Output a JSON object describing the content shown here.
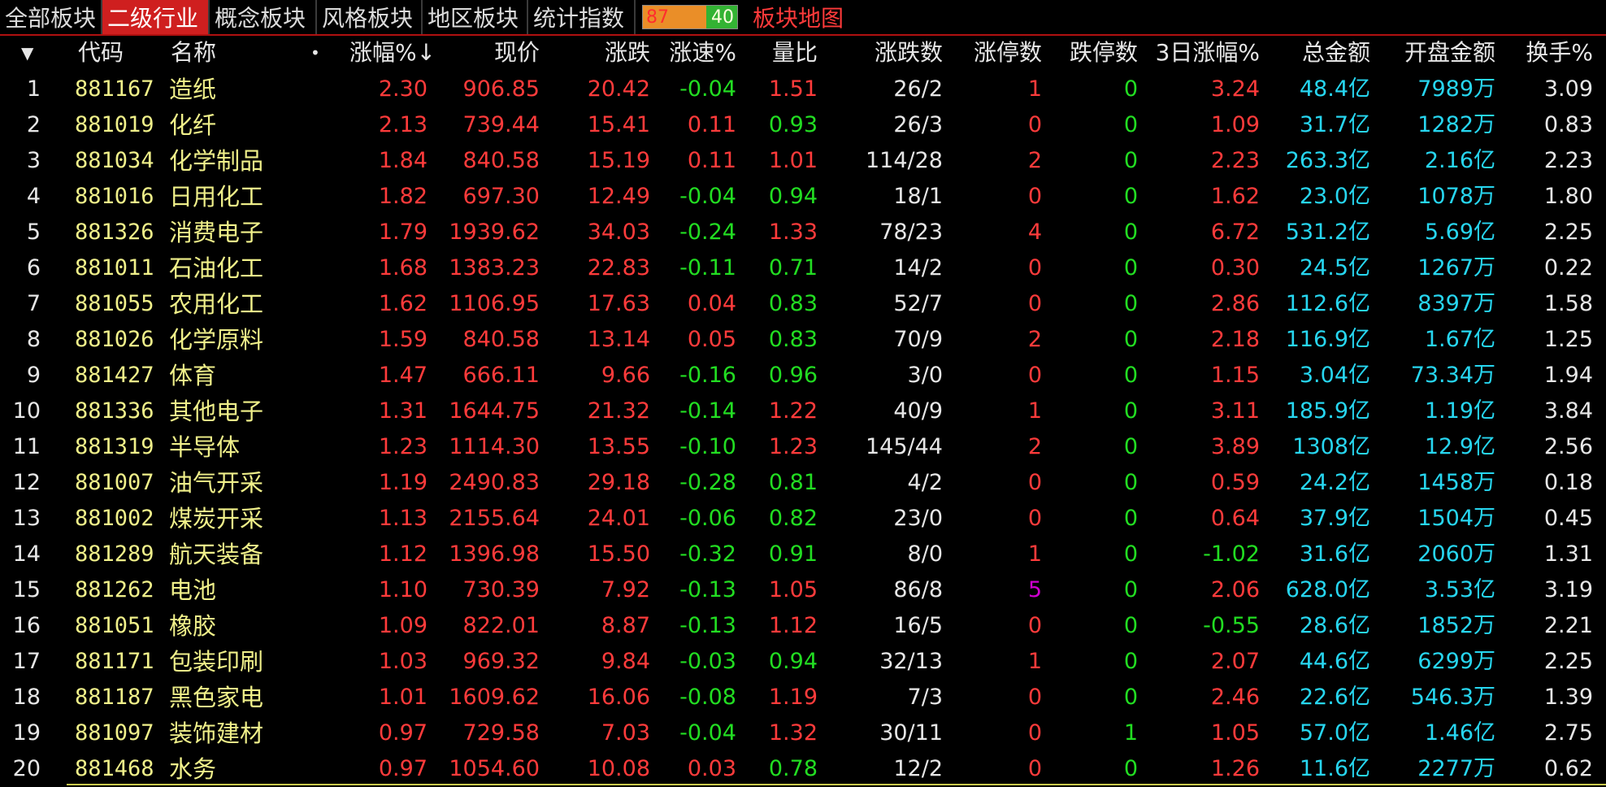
{
  "tabs": [
    {
      "label": "全部板块",
      "active": false
    },
    {
      "label": "二级行业",
      "active": true
    },
    {
      "label": "概念板块",
      "active": false
    },
    {
      "label": "风格板块",
      "active": false
    },
    {
      "label": "地区板块",
      "active": false
    },
    {
      "label": "统计指数",
      "active": false
    }
  ],
  "ratio": {
    "up": "87",
    "down": "40"
  },
  "map_link": "板块地图",
  "header": {
    "dropdown": "▼",
    "code": "代码",
    "name": "名称",
    "dot": "•",
    "change_pct": "涨幅%",
    "sort_arrow": "↓",
    "price": "现价",
    "change": "涨跌",
    "speed": "涨速%",
    "vol_ratio": "量比",
    "up_down": "涨跌数",
    "limit_up": "涨停数",
    "limit_down": "跌停数",
    "chg3": "3日涨幅%",
    "amount": "总金额",
    "open_amount": "开盘金额",
    "turnover": "换手%"
  },
  "rows": [
    {
      "idx": "1",
      "code": "881167",
      "name": "造纸",
      "pct": "2.30",
      "price": "906.85",
      "chg": "20.42",
      "speed": "-0.04",
      "vr": "1.51",
      "ud": "26/2",
      "lu": "1",
      "ld": "0",
      "c3": "3.24",
      "amt": "48.4亿",
      "open": "7989万",
      "to": "3.09"
    },
    {
      "idx": "2",
      "code": "881019",
      "name": "化纤",
      "pct": "2.13",
      "price": "739.44",
      "chg": "15.41",
      "speed": "0.11",
      "vr": "0.93",
      "ud": "26/3",
      "lu": "0",
      "ld": "0",
      "c3": "1.09",
      "amt": "31.7亿",
      "open": "1282万",
      "to": "0.83"
    },
    {
      "idx": "3",
      "code": "881034",
      "name": "化学制品",
      "pct": "1.84",
      "price": "840.58",
      "chg": "15.19",
      "speed": "0.11",
      "vr": "1.01",
      "ud": "114/28",
      "lu": "2",
      "ld": "0",
      "c3": "2.23",
      "amt": "263.3亿",
      "open": "2.16亿",
      "to": "2.23"
    },
    {
      "idx": "4",
      "code": "881016",
      "name": "日用化工",
      "pct": "1.82",
      "price": "697.30",
      "chg": "12.49",
      "speed": "-0.04",
      "vr": "0.94",
      "ud": "18/1",
      "lu": "0",
      "ld": "0",
      "c3": "1.62",
      "amt": "23.0亿",
      "open": "1078万",
      "to": "1.80"
    },
    {
      "idx": "5",
      "code": "881326",
      "name": "消费电子",
      "pct": "1.79",
      "price": "1939.62",
      "chg": "34.03",
      "speed": "-0.24",
      "vr": "1.33",
      "ud": "78/23",
      "lu": "4",
      "ld": "0",
      "c3": "6.72",
      "amt": "531.2亿",
      "open": "5.69亿",
      "to": "2.25"
    },
    {
      "idx": "6",
      "code": "881011",
      "name": "石油化工",
      "pct": "1.68",
      "price": "1383.23",
      "chg": "22.83",
      "speed": "-0.11",
      "vr": "0.71",
      "ud": "14/2",
      "lu": "0",
      "ld": "0",
      "c3": "0.30",
      "amt": "24.5亿",
      "open": "1267万",
      "to": "0.22"
    },
    {
      "idx": "7",
      "code": "881055",
      "name": "农用化工",
      "pct": "1.62",
      "price": "1106.95",
      "chg": "17.63",
      "speed": "0.04",
      "vr": "0.83",
      "ud": "52/7",
      "lu": "0",
      "ld": "0",
      "c3": "2.86",
      "amt": "112.6亿",
      "open": "8397万",
      "to": "1.58"
    },
    {
      "idx": "8",
      "code": "881026",
      "name": "化学原料",
      "pct": "1.59",
      "price": "840.58",
      "chg": "13.14",
      "speed": "0.05",
      "vr": "0.83",
      "ud": "70/9",
      "lu": "2",
      "ld": "0",
      "c3": "2.18",
      "amt": "116.9亿",
      "open": "1.67亿",
      "to": "1.25"
    },
    {
      "idx": "9",
      "code": "881427",
      "name": "体育",
      "pct": "1.47",
      "price": "666.11",
      "chg": "9.66",
      "speed": "-0.16",
      "vr": "0.96",
      "ud": "3/0",
      "lu": "0",
      "ld": "0",
      "c3": "1.15",
      "amt": "3.04亿",
      "open": "73.34万",
      "to": "1.94"
    },
    {
      "idx": "10",
      "code": "881336",
      "name": "其他电子",
      "pct": "1.31",
      "price": "1644.75",
      "chg": "21.32",
      "speed": "-0.14",
      "vr": "1.22",
      "ud": "40/9",
      "lu": "1",
      "ld": "0",
      "c3": "3.11",
      "amt": "185.9亿",
      "open": "1.19亿",
      "to": "3.84"
    },
    {
      "idx": "11",
      "code": "881319",
      "name": "半导体",
      "pct": "1.23",
      "price": "1114.30",
      "chg": "13.55",
      "speed": "-0.10",
      "vr": "1.23",
      "ud": "145/44",
      "lu": "2",
      "ld": "0",
      "c3": "3.89",
      "amt": "1308亿",
      "open": "12.9亿",
      "to": "2.56"
    },
    {
      "idx": "12",
      "code": "881007",
      "name": "油气开采",
      "pct": "1.19",
      "price": "2490.83",
      "chg": "29.18",
      "speed": "-0.28",
      "vr": "0.81",
      "ud": "4/2",
      "lu": "0",
      "ld": "0",
      "c3": "0.59",
      "amt": "24.2亿",
      "open": "1458万",
      "to": "0.18"
    },
    {
      "idx": "13",
      "code": "881002",
      "name": "煤炭开采",
      "pct": "1.13",
      "price": "2155.64",
      "chg": "24.01",
      "speed": "-0.06",
      "vr": "0.82",
      "ud": "23/0",
      "lu": "0",
      "ld": "0",
      "c3": "0.64",
      "amt": "37.9亿",
      "open": "1504万",
      "to": "0.45"
    },
    {
      "idx": "14",
      "code": "881289",
      "name": "航天装备",
      "pct": "1.12",
      "price": "1396.98",
      "chg": "15.50",
      "speed": "-0.32",
      "vr": "0.91",
      "ud": "8/0",
      "lu": "1",
      "ld": "0",
      "c3": "-1.02",
      "amt": "31.6亿",
      "open": "2060万",
      "to": "1.31"
    },
    {
      "idx": "15",
      "code": "881262",
      "name": "电池",
      "pct": "1.10",
      "price": "730.39",
      "chg": "7.92",
      "speed": "-0.13",
      "vr": "1.05",
      "ud": "86/8",
      "lu": "5",
      "ld": "0",
      "c3": "2.06",
      "amt": "628.0亿",
      "open": "3.53亿",
      "to": "3.19"
    },
    {
      "idx": "16",
      "code": "881051",
      "name": "橡胶",
      "pct": "1.09",
      "price": "822.01",
      "chg": "8.87",
      "speed": "-0.13",
      "vr": "1.12",
      "ud": "16/5",
      "lu": "0",
      "ld": "0",
      "c3": "-0.55",
      "amt": "28.6亿",
      "open": "1852万",
      "to": "2.21"
    },
    {
      "idx": "17",
      "code": "881171",
      "name": "包装印刷",
      "pct": "1.03",
      "price": "969.32",
      "chg": "9.84",
      "speed": "-0.03",
      "vr": "0.94",
      "ud": "32/13",
      "lu": "1",
      "ld": "0",
      "c3": "2.07",
      "amt": "44.6亿",
      "open": "6299万",
      "to": "2.25"
    },
    {
      "idx": "18",
      "code": "881187",
      "name": "黑色家电",
      "pct": "1.01",
      "price": "1609.62",
      "chg": "16.06",
      "speed": "-0.08",
      "vr": "1.19",
      "ud": "7/3",
      "lu": "0",
      "ld": "0",
      "c3": "2.46",
      "amt": "22.6亿",
      "open": "546.3万",
      "to": "1.39"
    },
    {
      "idx": "19",
      "code": "881097",
      "name": "装饰建材",
      "pct": "0.97",
      "price": "729.58",
      "chg": "7.03",
      "speed": "-0.04",
      "vr": "1.32",
      "ud": "30/11",
      "lu": "0",
      "ld": "1",
      "c3": "1.05",
      "amt": "57.0亿",
      "open": "1.46亿",
      "to": "2.75"
    },
    {
      "idx": "20",
      "code": "881468",
      "name": "水务",
      "pct": "0.97",
      "price": "1054.60",
      "chg": "10.08",
      "speed": "0.03",
      "vr": "0.78",
      "ud": "12/2",
      "lu": "0",
      "ld": "0",
      "c3": "1.26",
      "amt": "11.6亿",
      "open": "2277万",
      "to": "0.62"
    }
  ],
  "colors": {
    "up": "#ff3b3b",
    "down": "#22dd22",
    "code": "#f0f08a",
    "amount": "#27d6f0",
    "limit_up_high": "#d000d0",
    "active_tab": "#cf1f1f"
  }
}
